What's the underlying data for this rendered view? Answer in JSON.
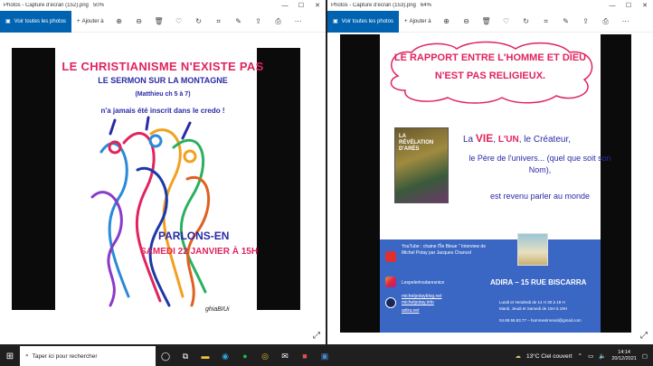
{
  "window1": {
    "title": "Photos - Capture d'écran (152).png",
    "zoom": "50%",
    "toolbar": {
      "see_all": "Voir toutes les photos",
      "add_to": "Ajouter à"
    }
  },
  "window2": {
    "title": "Photos - Capture d'écran (153).png",
    "zoom": "64%",
    "toolbar": {
      "see_all": "Voir toutes les photos",
      "add_to": "Ajouter à"
    }
  },
  "poster1": {
    "title": "LE CHRISTIANISME N'EXISTE PAS",
    "subtitle": "LE SERMON SUR LA MONTAGNE",
    "reference": "(Matthieu ch 5 à 7)",
    "credo": "n'a jamais été inscrit dans le credo !",
    "parlons": "PARLONS-EN",
    "date": "SAMEDI 22 JANVIER À 15H",
    "signature": "ghiaBIUi"
  },
  "poster2": {
    "cloud_line1": "LE RAPPORT ENTRE L'HOMME ET DIEU",
    "cloud_line2": "N'EST PAS RELIGIEUX.",
    "book_text": "LA RÉVÉLATION D'ARÈS",
    "vie_prefix": "La ",
    "vie_word": "VIE",
    "vie_mid": ", ",
    "un_word": "L'UN",
    "vie_end": ", le Créateur,",
    "pere": "le Père de l'univers... (quel que soit son Nom),",
    "revenu": "est revenu parler au monde",
    "youtube": "YouTube : chaine l'Île Bleue \" Interview de Michel Potay par Jacques Chancel",
    "pelerins": "Lespelerinsdaresnice",
    "link1": "michelpotayblog.net",
    "link2": "michelpotay.info",
    "link3": "adira.net",
    "adira": "ADIRA – 15 RUE BISCARRA",
    "hours1": "Lundi et Vendredi de 14 H 30 à 19 H",
    "hours2": "Mardi, Jeudi et Samedi de 15H à 19H",
    "contact": "04.89.55.83.77 – hommeslnresol@gmail.com"
  },
  "taskbar": {
    "search_placeholder": "Taper ici pour rechercher",
    "weather": "13°C Ciel couvert",
    "time": "14:14",
    "date": "20/12/2021"
  }
}
